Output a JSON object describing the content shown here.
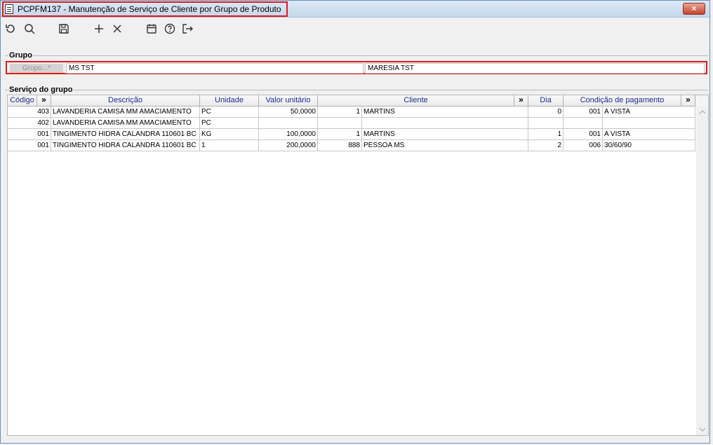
{
  "window": {
    "title": "PCPFM137 - Manutenção de Serviço de Cliente por Grupo de Produto",
    "close_label": "×"
  },
  "toolbar": {
    "icons": [
      "undo-icon",
      "search-icon",
      "save-icon",
      "add-icon",
      "delete-icon",
      "calendar-icon",
      "help-icon",
      "exit-icon"
    ]
  },
  "grupo": {
    "section_title": "Grupo",
    "label": "Grupo...*",
    "code": "MS TST",
    "description": "MARESIA TST"
  },
  "servico": {
    "section_title": "Serviço do grupo",
    "columns": {
      "codigo": "Código",
      "arrow1": "»",
      "descricao": "Descrição",
      "unidade": "Unidade",
      "valor": "Valor unitário",
      "cliente": "Cliente",
      "arrow2": "»",
      "dia": "Dia",
      "condicao": "Condição de pagamento",
      "arrow3": "»"
    },
    "rows": [
      {
        "codigo": "403",
        "descricao": "LAVANDERIA CAMISA MM AMACIAMENTO",
        "unidade": "PC",
        "valor": "50,0000",
        "cliente_cod": "1",
        "cliente_nome": "MARTINS",
        "dia": "0",
        "cond_cod": "001",
        "cond_desc": "A VISTA"
      },
      {
        "codigo": "402",
        "descricao": "LAVANDERIA CAMISA MM AMACIAMENTO",
        "unidade": "PC",
        "valor": "",
        "cliente_cod": "",
        "cliente_nome": "",
        "dia": "",
        "cond_cod": "",
        "cond_desc": ""
      },
      {
        "codigo": "001",
        "descricao": "TINGIMENTO HIDRA CALANDRA 110601 BC",
        "unidade": "KG",
        "valor": "100,0000",
        "cliente_cod": "1",
        "cliente_nome": "MARTINS",
        "dia": "1",
        "cond_cod": "001",
        "cond_desc": "A VISTA"
      },
      {
        "codigo": "001",
        "descricao": "TINGIMENTO HIDRA CALANDRA 110601 BC",
        "unidade": "1",
        "valor": "200,0000",
        "cliente_cod": "888",
        "cliente_nome": "PESSOA MS",
        "dia": "2",
        "cond_cod": "006",
        "cond_desc": "30/60/90"
      }
    ]
  },
  "colors": {
    "highlight": "#e0191b",
    "header_text": "#1b2b8f"
  }
}
